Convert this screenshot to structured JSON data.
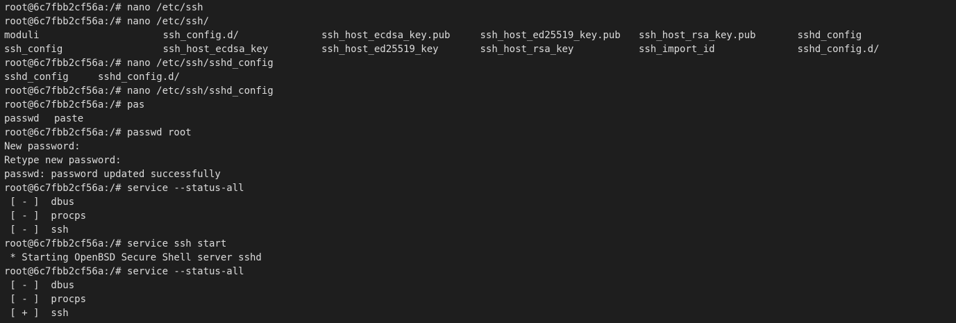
{
  "terminal": {
    "background": "#1e1e1e",
    "foreground": "#dcdcdc",
    "lines": {
      "l01": "root@6c7fbb2cf56a:/# nano /etc/ssh",
      "l02": "root@6c7fbb2cf56a:/# nano /etc/ssh/",
      "l05": "root@6c7fbb2cf56a:/# nano /etc/ssh/sshd_config",
      "l07": "root@6c7fbb2cf56a:/# nano /etc/ssh/sshd_config",
      "l08": "root@6c7fbb2cf56a:/# pas",
      "l10": "root@6c7fbb2cf56a:/# passwd root",
      "l11": "New password:",
      "l12": "Retype new password:",
      "l13": "passwd: password updated successfully",
      "l14": "root@6c7fbb2cf56a:/# service --status-all",
      "l15": " [ - ]  dbus",
      "l16": " [ - ]  procps",
      "l17": " [ - ]  ssh",
      "l18": "root@6c7fbb2cf56a:/# service ssh start",
      "l19": " * Starting OpenBSD Secure Shell server sshd",
      "l20": "root@6c7fbb2cf56a:/# service --status-all",
      "l21": " [ - ]  dbus",
      "l22": " [ - ]  procps",
      "l23": " [ + ]  ssh"
    },
    "ls_row1": [
      "moduli",
      "ssh_config.d/",
      "ssh_host_ecdsa_key.pub",
      "ssh_host_ed25519_key.pub",
      "ssh_host_rsa_key.pub",
      "sshd_config"
    ],
    "ls_row2": [
      "ssh_config",
      "ssh_host_ecdsa_key",
      "ssh_host_ed25519_key",
      "ssh_host_rsa_key",
      "ssh_import_id",
      "sshd_config.d/"
    ],
    "completion_1": [
      "sshd_config",
      "sshd_config.d/"
    ],
    "completion_2": [
      "passwd",
      "paste"
    ]
  }
}
